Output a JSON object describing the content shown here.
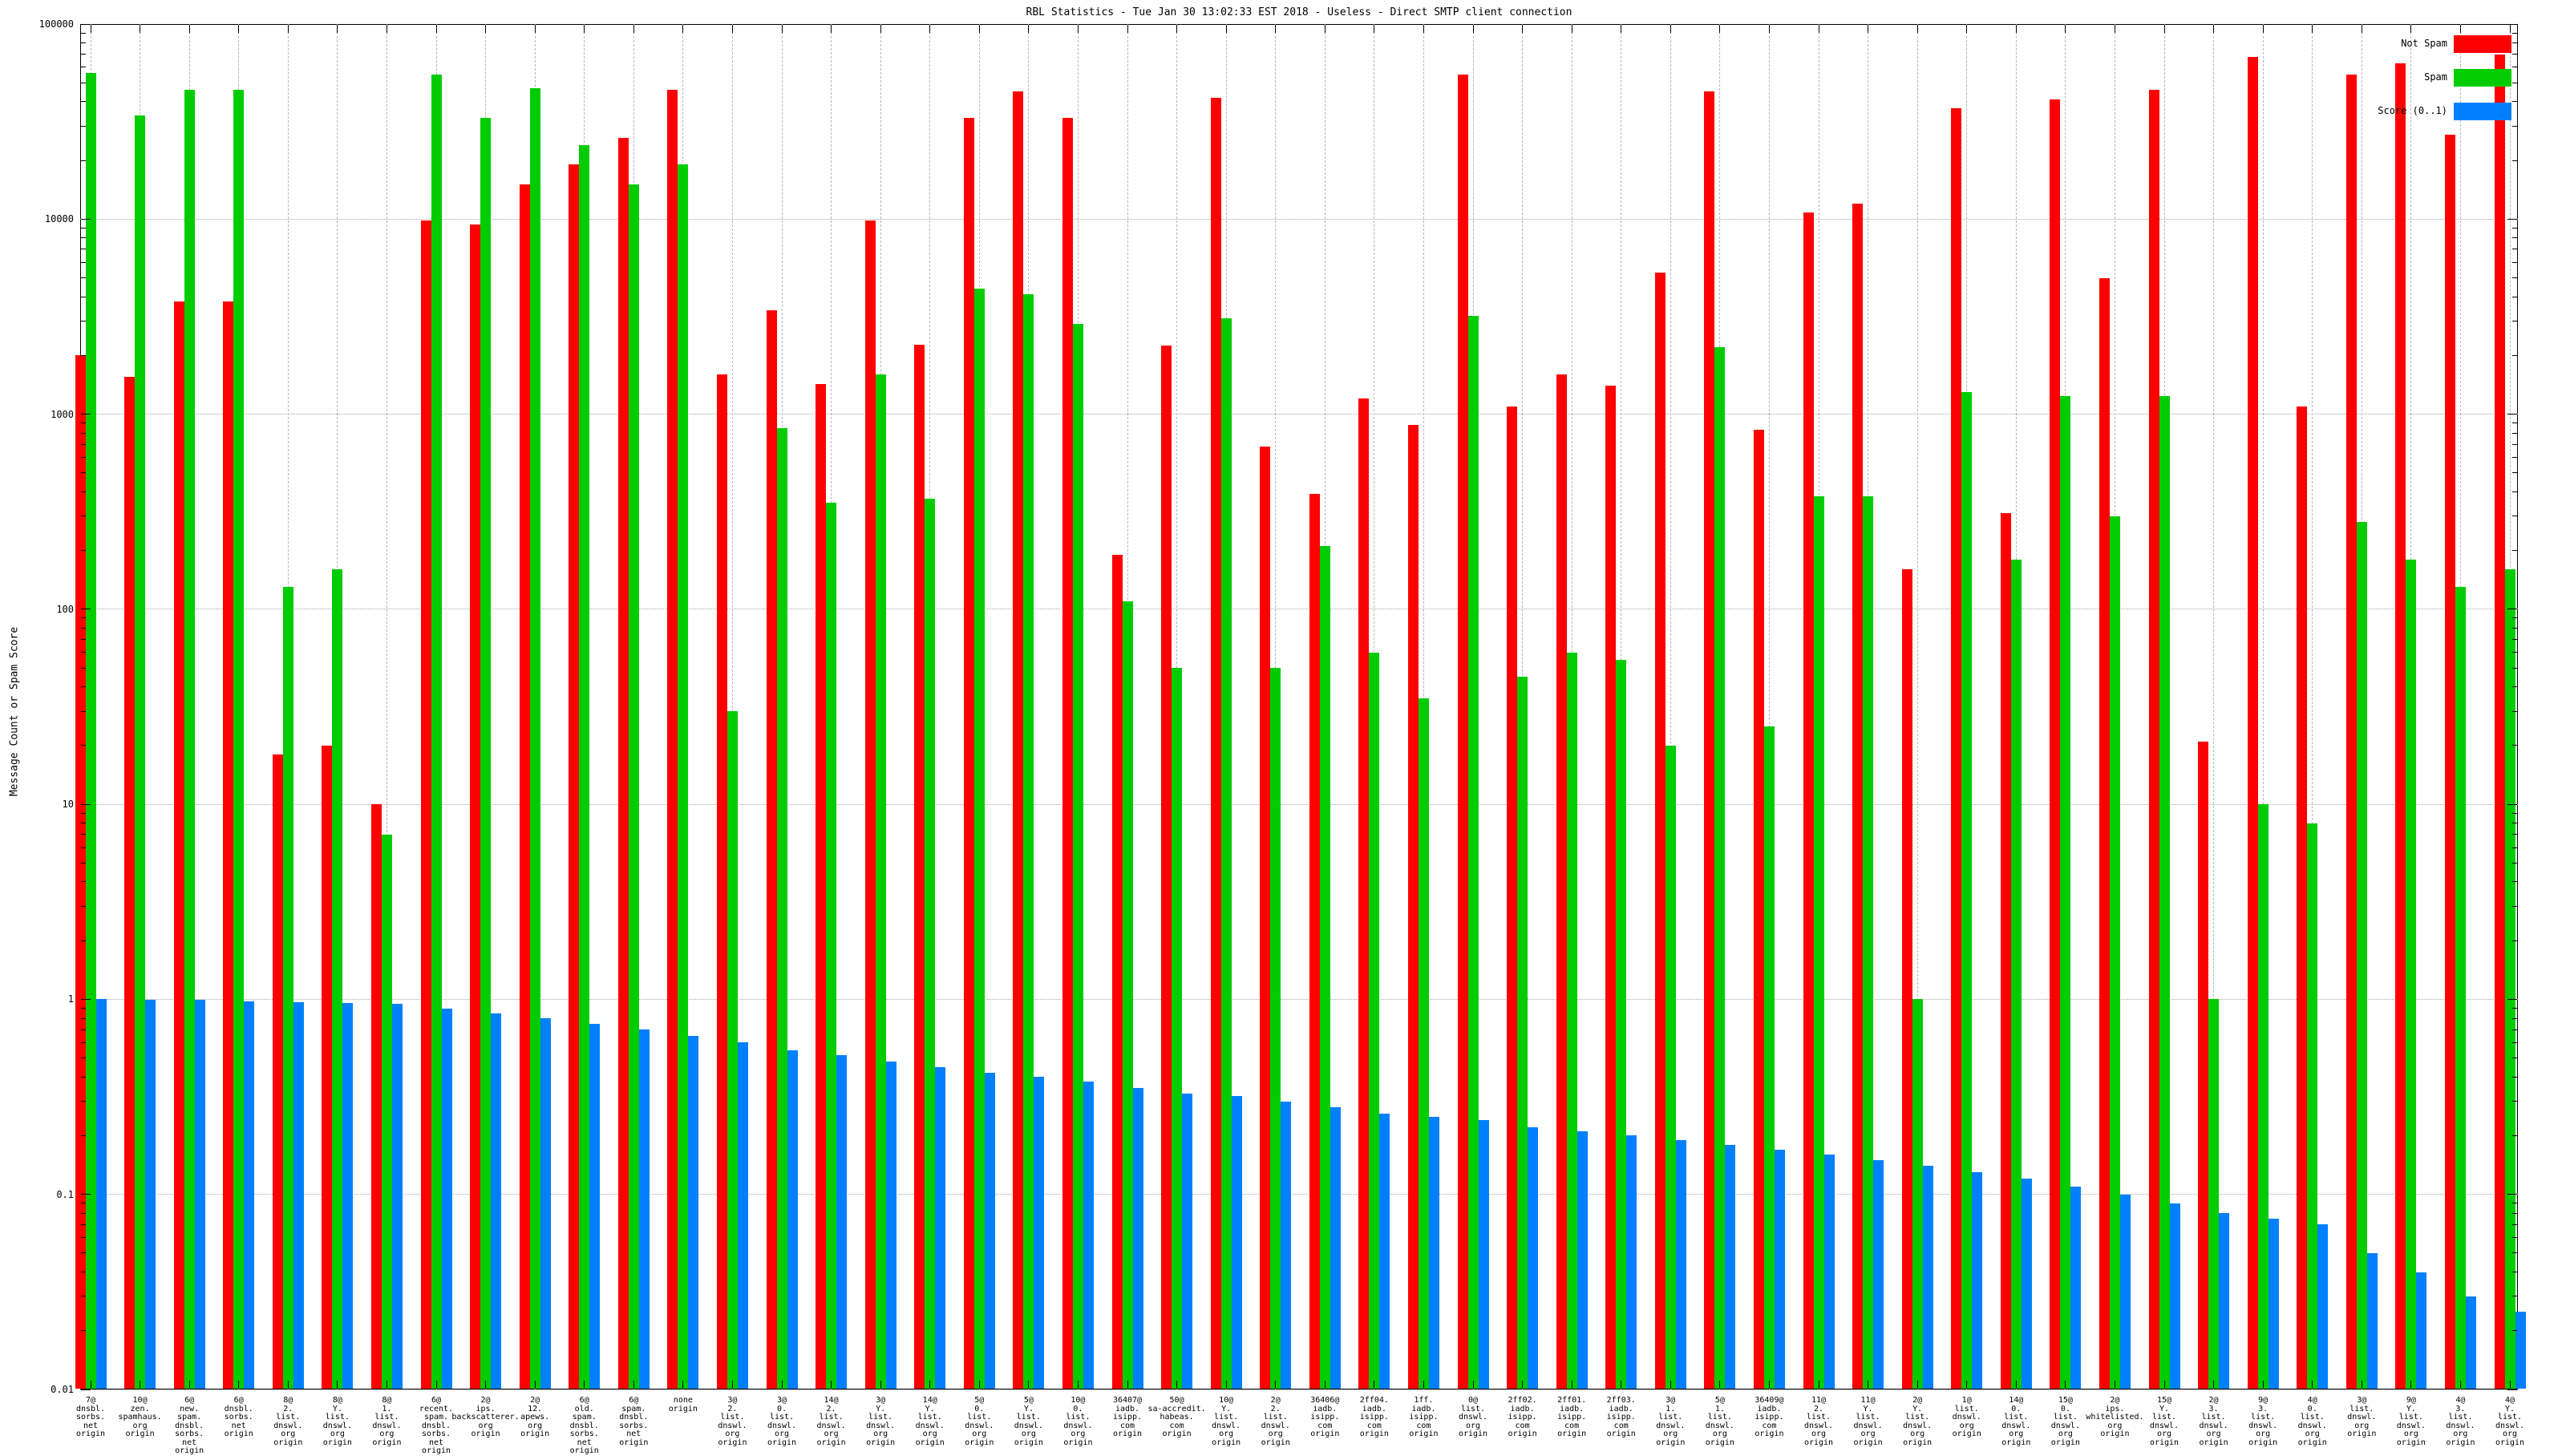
{
  "title": "RBL Statistics - Tue Jan 30 13:02:33 EST 2018 - Useless - Direct SMTP client connection",
  "chart_data": {
    "type": "bar",
    "title": "RBL Statistics - Tue Jan 30 13:02:33 EST 2018 - Useless - Direct SMTP client connection",
    "xlabel": "",
    "ylabel": "Message Count or Spam Score",
    "y_scale": "log",
    "ylim": [
      0.01,
      100000
    ],
    "ytick_labels": [
      "100000",
      "10000",
      "1000",
      "100",
      "10",
      "1",
      "0.1",
      "0.01"
    ],
    "grid": true,
    "legend_position": "top-right-inside",
    "colors": {
      "not_spam": "#ff0000",
      "spam": "#00cc00",
      "score": "#0080ff",
      "grid_h": "#a8a8a8",
      "grid_v": "#b8b8b8",
      "axis": "#000000",
      "background": "#ffffff"
    },
    "categories": [
      "7@ dnsbl. sorbs. net origin",
      "10@ zen. spamhaus. org origin",
      "6@ new. spam. dnsbl. sorbs. net origin",
      "6@ dnsbl. sorbs. net origin",
      "8@ 2. list. dnswl. org origin",
      "8@ Y. list. dnswl. org origin",
      "8@ 1. list. dnswl. org origin",
      "6@ recent. spam. dnsbl. sorbs. net origin",
      "2@ ips. backscatterer. org origin",
      "2@ 12. apews. org origin",
      "6@ old. spam. dnsbl. sorbs. net origin",
      "6@ spam. dnsbl. sorbs. net origin",
      "none origin",
      "3@ 2. list. dnswl. org origin",
      "3@ 0. list. dnswl. org origin",
      "14@ 2. list. dnswl. org origin",
      "3@ Y. list. dnswl. org origin",
      "14@ Y. list. dnswl. org origin",
      "5@ 0. list. dnswl. org origin",
      "5@ Y. list. dnswl. org origin",
      "10@ 0. list. dnswl. org origin",
      "36407@ iadb. isipp. com origin",
      "50@ sa-accredit. habeas. com origin",
      "10@ Y. list. dnswl. org origin",
      "2@ 2. list. dnswl. org origin",
      "36406@ iadb. isipp. com origin",
      "2ff04. iadb. isipp. com origin",
      "1ff. iadb. isipp. com origin",
      "0@ list. dnswl. org origin",
      "2ff02. iadb. isipp. com origin",
      "2ff01. iadb. isipp. com origin",
      "2ff03. iadb. isipp. com origin",
      "3@ 1. list. dnswl. org origin",
      "5@ 1. list. dnswl. org origin",
      "36409@ iadb. isipp. com origin",
      "11@ 2. list. dnswl. org origin",
      "11@ Y. list. dnswl. org origin",
      "2@ Y. list. dnswl. org origin",
      "1@ list. dnswl. org origin",
      "14@ 0. list. dnswl. org origin",
      "15@ 0. list. dnswl. org origin",
      "2@ ips. whitelisted. org origin",
      "15@ Y. list. dnswl. org origin",
      "2@ 3. list. dnswl. org origin",
      "9@ 3. list. dnswl. org origin",
      "4@ 0. list. dnswl. org origin",
      "3@ list. dnswl. org origin",
      "9@ Y. list. dnswl. org origin",
      "4@ 3. list. dnswl. org origin",
      "4@ Y. list. dnswl. org origin"
    ],
    "series": [
      {
        "name": "Not Spam",
        "color_key": "not_spam",
        "values": [
          2000,
          1550,
          3800,
          3800,
          18,
          20,
          10,
          9800,
          9400,
          15000,
          19000,
          26000,
          46000,
          1600,
          3400,
          1430,
          9800,
          2260,
          33000,
          45000,
          33000,
          190,
          2250,
          42000,
          680,
          390,
          1200,
          880,
          55000,
          1100,
          1600,
          1400,
          5300,
          45000,
          830,
          10800,
          12000,
          160,
          37000,
          310,
          41000,
          5000,
          46000,
          21,
          68000,
          1100,
          55000,
          63000,
          27000,
          70000
        ]
      },
      {
        "name": "Spam",
        "color_key": "spam",
        "values": [
          56000,
          34000,
          46000,
          46000,
          130,
          160,
          7,
          55000,
          33000,
          47000,
          24000,
          15000,
          19000,
          30,
          850,
          350,
          1600,
          370,
          4400,
          4100,
          2900,
          110,
          50,
          3100,
          50,
          210,
          60,
          35,
          3200,
          45,
          60,
          55,
          20,
          2200,
          25,
          380,
          380,
          1,
          1300,
          180,
          1240,
          300,
          1240,
          1,
          10,
          8,
          280,
          180,
          130,
          160
        ]
      },
      {
        "name": "Score (0..1)",
        "color_key": "score",
        "values": [
          1.0,
          0.99,
          0.99,
          0.98,
          0.97,
          0.96,
          0.95,
          0.9,
          0.85,
          0.8,
          0.75,
          0.7,
          0.65,
          0.6,
          0.55,
          0.52,
          0.48,
          0.45,
          0.42,
          0.4,
          0.38,
          0.35,
          0.33,
          0.32,
          0.3,
          0.28,
          0.26,
          0.25,
          0.24,
          0.22,
          0.21,
          0.2,
          0.19,
          0.18,
          0.17,
          0.16,
          0.15,
          0.14,
          0.13,
          0.12,
          0.11,
          0.1,
          0.09,
          0.08,
          0.075,
          0.07,
          0.05,
          0.04,
          0.03,
          0.025
        ]
      }
    ]
  }
}
